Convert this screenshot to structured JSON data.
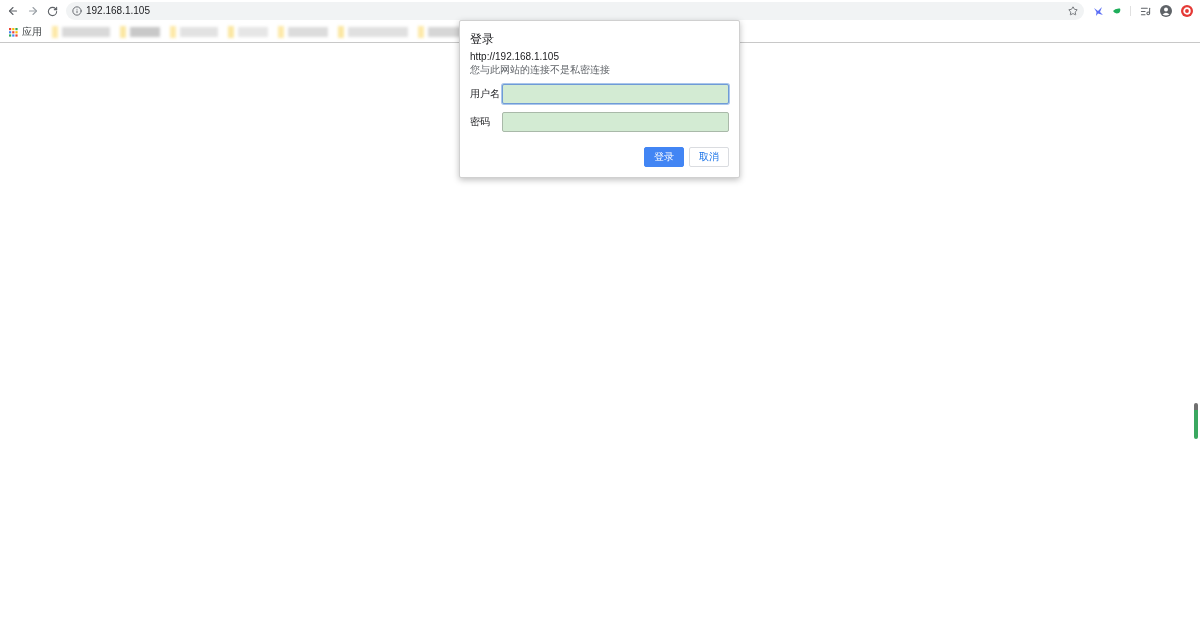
{
  "toolbar": {
    "address": "192.168.1.105"
  },
  "bookmarks_bar": {
    "apps_label": "应用"
  },
  "dialog": {
    "title": "登录",
    "origin": "http://192.168.1.105",
    "notice": "您与此网站的连接不是私密连接",
    "fields": [
      {
        "label": "用户名",
        "focused": true,
        "autofilled": true
      },
      {
        "label": "密码",
        "focused": false,
        "autofilled": true
      }
    ],
    "buttons": [
      {
        "label": "登录",
        "kind": "primary"
      },
      {
        "label": "取消",
        "kind": "secondary"
      }
    ]
  }
}
